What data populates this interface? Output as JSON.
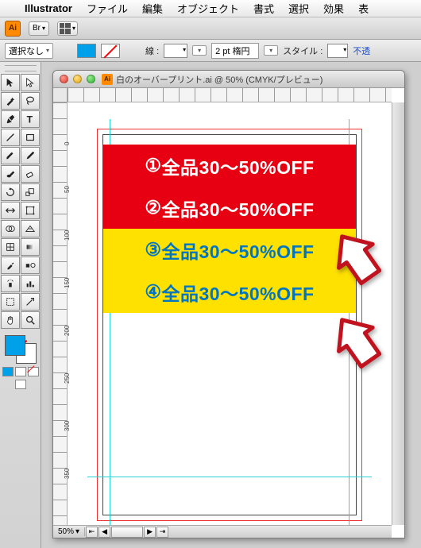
{
  "menubar": {
    "apple": "",
    "app": "Illustrator",
    "items": [
      "ファイル",
      "編集",
      "オブジェクト",
      "書式",
      "選択",
      "効果",
      "表"
    ]
  },
  "appheader": {
    "badge": "Ai",
    "br_label": "Br"
  },
  "controlbar": {
    "selection": "選択なし",
    "stroke_label": "線 :",
    "stroke_weight": "2 pt 楕円",
    "style_label": "スタイル :",
    "truncated": "不透"
  },
  "ruler": {
    "v": [
      "0",
      "50",
      "100",
      "150",
      "200",
      "250",
      "300",
      "350"
    ]
  },
  "document": {
    "title": "白のオーバープリント.ai @ 50% (CMYK/プレビュー)",
    "zoom": "50%"
  },
  "banners": [
    {
      "num": "①",
      "text": "全品30〜50%OFF"
    },
    {
      "num": "②",
      "text": "全品30〜50%OFF"
    },
    {
      "num": "③",
      "text": "全品30〜50%OFF"
    },
    {
      "num": "④",
      "text": "全品30〜50%OFF"
    }
  ]
}
